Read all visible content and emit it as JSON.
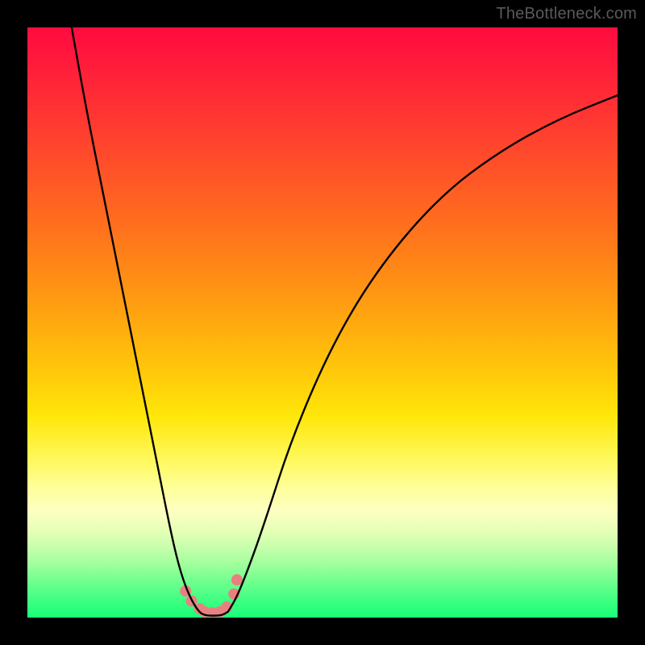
{
  "watermark": "TheBottleneck.com",
  "chart_data": {
    "type": "line",
    "title": "",
    "xlabel": "",
    "ylabel": "",
    "xlim": [
      0,
      1
    ],
    "ylim": [
      0,
      1
    ],
    "series": [
      {
        "name": "left-branch",
        "x": [
          0.075,
          0.1,
          0.13,
          0.16,
          0.19,
          0.22,
          0.245,
          0.26,
          0.275,
          0.29
        ],
        "y": [
          1.0,
          0.86,
          0.71,
          0.56,
          0.41,
          0.26,
          0.135,
          0.075,
          0.035,
          0.01
        ]
      },
      {
        "name": "right-branch",
        "x": [
          0.34,
          0.355,
          0.375,
          0.4,
          0.45,
          0.52,
          0.6,
          0.7,
          0.8,
          0.9,
          1.0
        ],
        "y": [
          0.01,
          0.035,
          0.085,
          0.155,
          0.31,
          0.47,
          0.6,
          0.715,
          0.79,
          0.845,
          0.885
        ]
      },
      {
        "name": "flat-bottom",
        "x": [
          0.29,
          0.3,
          0.315,
          0.33,
          0.34
        ],
        "y": [
          0.01,
          0.004,
          0.003,
          0.004,
          0.01
        ]
      }
    ],
    "markers": {
      "name": "bottom-dots",
      "color": "#e57373",
      "points": [
        {
          "x": 0.268,
          "y": 0.045
        },
        {
          "x": 0.278,
          "y": 0.028
        },
        {
          "x": 0.292,
          "y": 0.015
        },
        {
          "x": 0.3,
          "y": 0.01
        },
        {
          "x": 0.314,
          "y": 0.008
        },
        {
          "x": 0.327,
          "y": 0.01
        },
        {
          "x": 0.338,
          "y": 0.018
        },
        {
          "x": 0.35,
          "y": 0.04
        },
        {
          "x": 0.355,
          "y": 0.064
        }
      ]
    },
    "curve_style": {
      "stroke": "#000000",
      "stroke_width": 2.4
    },
    "marker_style": {
      "radius": 7,
      "fill": "#e98080"
    }
  }
}
